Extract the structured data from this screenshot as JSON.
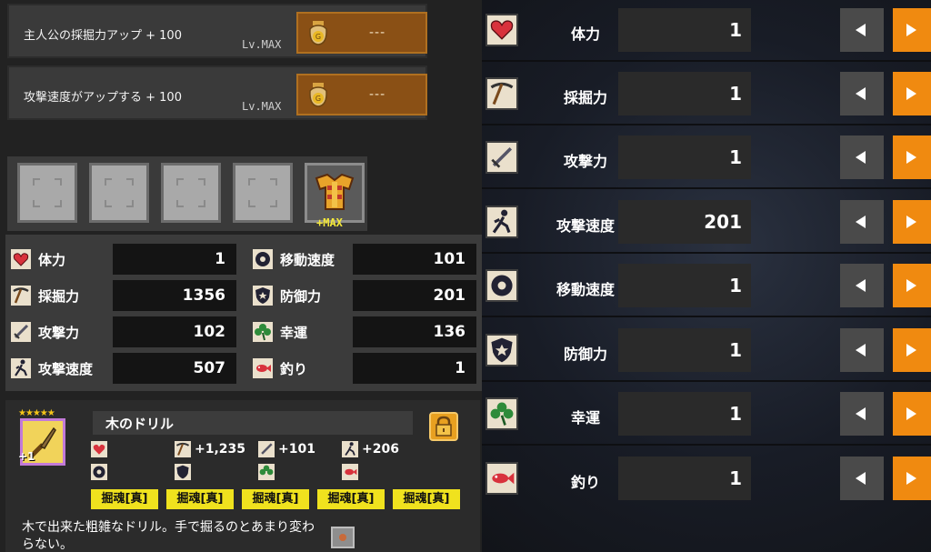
{
  "upgrades": [
    {
      "label": "主人公の採掘力アップ + 100",
      "level": "Lv.MAX",
      "cost": "---",
      "icon": "money-bag-icon"
    },
    {
      "label": "攻撃速度がアップする + 100",
      "level": "Lv.MAX",
      "cost": "---",
      "icon": "money-bag-icon"
    }
  ],
  "equipment": {
    "gear_badge": "+MAX"
  },
  "stats_left": [
    {
      "name": "体力",
      "value": "1",
      "icon": "heart-icon"
    },
    {
      "name": "採掘力",
      "value": "1356",
      "icon": "pickaxe-icon"
    },
    {
      "name": "攻撃力",
      "value": "102",
      "icon": "sword-icon"
    },
    {
      "name": "攻撃速度",
      "value": "507",
      "icon": "running-man-icon"
    }
  ],
  "stats_right": [
    {
      "name": "移動速度",
      "value": "101",
      "icon": "speed-wheel-icon"
    },
    {
      "name": "防御力",
      "value": "201",
      "icon": "shield-icon"
    },
    {
      "name": "幸運",
      "value": "136",
      "icon": "clover-icon"
    },
    {
      "name": "釣り",
      "value": "1",
      "icon": "fish-icon"
    }
  ],
  "item": {
    "stars": "★★★★★",
    "enhance": "+1",
    "name": "木のドリル",
    "bonuses": [
      "",
      "+1,235",
      "+101",
      "+206",
      "",
      "",
      "",
      ""
    ],
    "tags": [
      "掘魂[真]",
      "掘魂[真]",
      "掘魂[真]",
      "掘魂[真]",
      "掘魂[真]"
    ],
    "description": "木で出来た粗雑なドリル。手で掘るのとあまり変わらない。"
  },
  "allocation": [
    {
      "name": "体力",
      "value": "1",
      "icon": "heart-icon"
    },
    {
      "name": "採掘力",
      "value": "1",
      "icon": "pickaxe-icon"
    },
    {
      "name": "攻撃力",
      "value": "1",
      "icon": "sword-icon"
    },
    {
      "name": "攻撃速度",
      "value": "201",
      "icon": "running-man-icon"
    },
    {
      "name": "移動速度",
      "value": "1",
      "icon": "speed-wheel-icon"
    },
    {
      "name": "防御力",
      "value": "1",
      "icon": "shield-icon"
    },
    {
      "name": "幸運",
      "value": "1",
      "icon": "clover-icon"
    },
    {
      "name": "釣り",
      "value": "1",
      "icon": "fish-icon"
    }
  ],
  "colors": {
    "accent": "#f08a10",
    "tag": "#f0e21e",
    "cost_bg": "#8a5015"
  }
}
